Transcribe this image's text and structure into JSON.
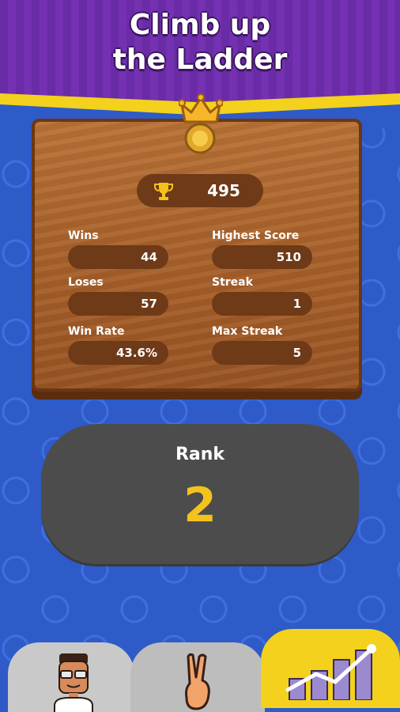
{
  "header": {
    "title_line1": "Climb up",
    "title_line2": "the Ladder"
  },
  "score": {
    "icon": "trophy-icon",
    "value": "495"
  },
  "stats": {
    "wins": {
      "label": "Wins",
      "value": "44"
    },
    "highest_score": {
      "label": "Highest Score",
      "value": "510"
    },
    "loses": {
      "label": "Loses",
      "value": "57"
    },
    "streak": {
      "label": "Streak",
      "value": "1"
    },
    "win_rate": {
      "label": "Win Rate",
      "value": "43.6%"
    },
    "max_streak": {
      "label": "Max Streak",
      "value": "5"
    }
  },
  "rank": {
    "label": "Rank",
    "value": "2"
  },
  "tabs": [
    {
      "icon": "profile-avatar-icon"
    },
    {
      "icon": "peace-hand-icon"
    },
    {
      "icon": "stats-chart-icon",
      "active": true
    }
  ],
  "colors": {
    "accent": "#f3d11c",
    "header": "#7431b2",
    "background": "#2e5bc8",
    "wood": "#a9622b",
    "rank_value": "#f4c21d"
  }
}
